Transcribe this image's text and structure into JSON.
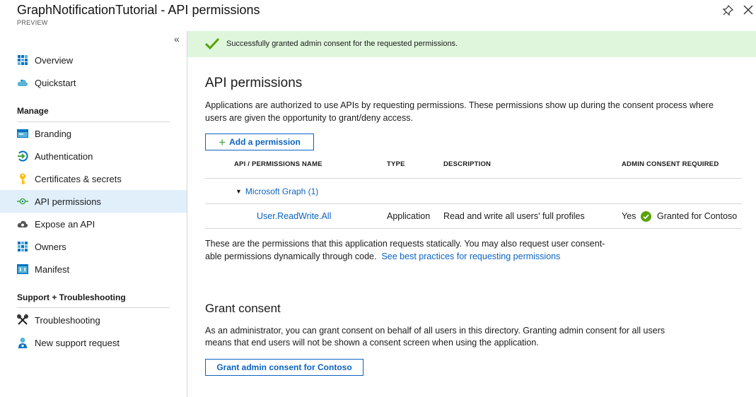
{
  "header": {
    "title": "GraphNotificationTutorial - API permissions",
    "subtitle": "PREVIEW"
  },
  "sidebar": {
    "collapse_glyph": "«",
    "items_top": [
      {
        "label": "Overview",
        "icon": "overview-grid-icon"
      },
      {
        "label": "Quickstart",
        "icon": "cloud-icon"
      }
    ],
    "manage_label": "Manage",
    "manage_items": [
      {
        "label": "Branding",
        "icon": "branding-icon"
      },
      {
        "label": "Authentication",
        "icon": "authentication-icon"
      },
      {
        "label": "Certificates & secrets",
        "icon": "key-icon"
      },
      {
        "label": "API permissions",
        "icon": "api-permissions-icon",
        "active": true
      },
      {
        "label": "Expose an API",
        "icon": "cloud-gear-icon"
      },
      {
        "label": "Owners",
        "icon": "owners-grid-icon"
      },
      {
        "label": "Manifest",
        "icon": "manifest-icon"
      }
    ],
    "support_label": "Support + Troubleshooting",
    "support_items": [
      {
        "label": "Troubleshooting",
        "icon": "wrench-icon"
      },
      {
        "label": "New support request",
        "icon": "person-support-icon"
      }
    ]
  },
  "banner": {
    "text": "Successfully granted admin consent for the requested permissions.",
    "color": "#dff6dd"
  },
  "main": {
    "heading": "API permissions",
    "intro_line1": "Applications are authorized to use APIs by requesting permissions. These permissions show up during the consent process where",
    "intro_line2": "users are given the opportunity to grant/deny access.",
    "add_button": "Add a permission",
    "table": {
      "headers": [
        "API / PERMISSIONS NAME",
        "TYPE",
        "DESCRIPTION",
        "ADMIN CONSENT REQUIRED"
      ],
      "group": "Microsoft Graph (1)",
      "rows": [
        {
          "name": "User.ReadWrite.All",
          "type": "Application",
          "description": "Read and write all users' full profiles",
          "consent_required": "Yes",
          "status": "Granted for Contoso"
        }
      ]
    },
    "note_line1": "These are the permissions that this application requests statically. You may also request user consent-",
    "note_line2": "able permissions dynamically through code.",
    "note_link": "See best practices for requesting permissions",
    "grant_heading": "Grant consent",
    "grant_line1": "As an administrator, you can grant consent on behalf of all users in this directory. Granting admin consent for all users",
    "grant_line2": "means that end users will not be shown a consent screen when using the application.",
    "grant_button": "Grant admin consent for Contoso"
  },
  "colors": {
    "accent": "#0b63c1",
    "success": "#57a300",
    "active_nav": "#e1effb"
  }
}
